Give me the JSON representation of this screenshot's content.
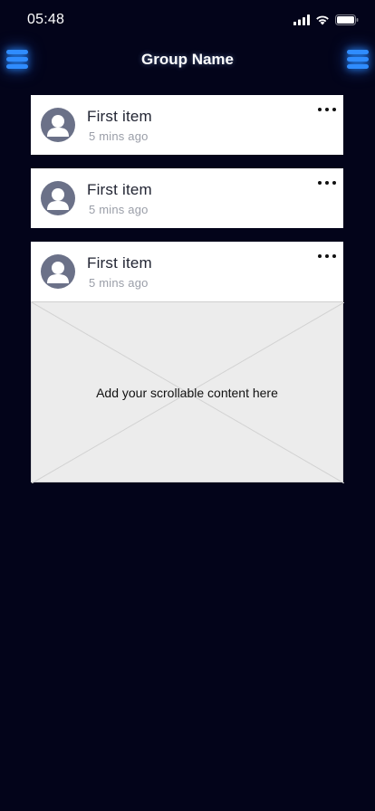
{
  "status_bar": {
    "time": "05:48",
    "icons": [
      "cellular-signal-icon",
      "wifi-icon",
      "battery-icon"
    ]
  },
  "header": {
    "title": "Group Name",
    "left_icon": "menu-icon",
    "right_icon": "menu-icon",
    "accent_color": "#2f8cff"
  },
  "feed": {
    "items": [
      {
        "title": "First item",
        "time": "5 mins ago",
        "avatar_icon": "user-avatar-icon",
        "more_icon": "more-options-icon"
      },
      {
        "title": "First item",
        "time": "5 mins ago",
        "avatar_icon": "user-avatar-icon",
        "more_icon": "more-options-icon"
      },
      {
        "title": "First item",
        "time": "5 mins ago",
        "avatar_icon": "user-avatar-icon",
        "more_icon": "more-options-icon",
        "content_placeholder": "Add your scrollable content here"
      }
    ]
  },
  "colors": {
    "background": "#03041a",
    "card": "#ffffff",
    "avatar": "#6b7188",
    "placeholder": "#ececec"
  }
}
